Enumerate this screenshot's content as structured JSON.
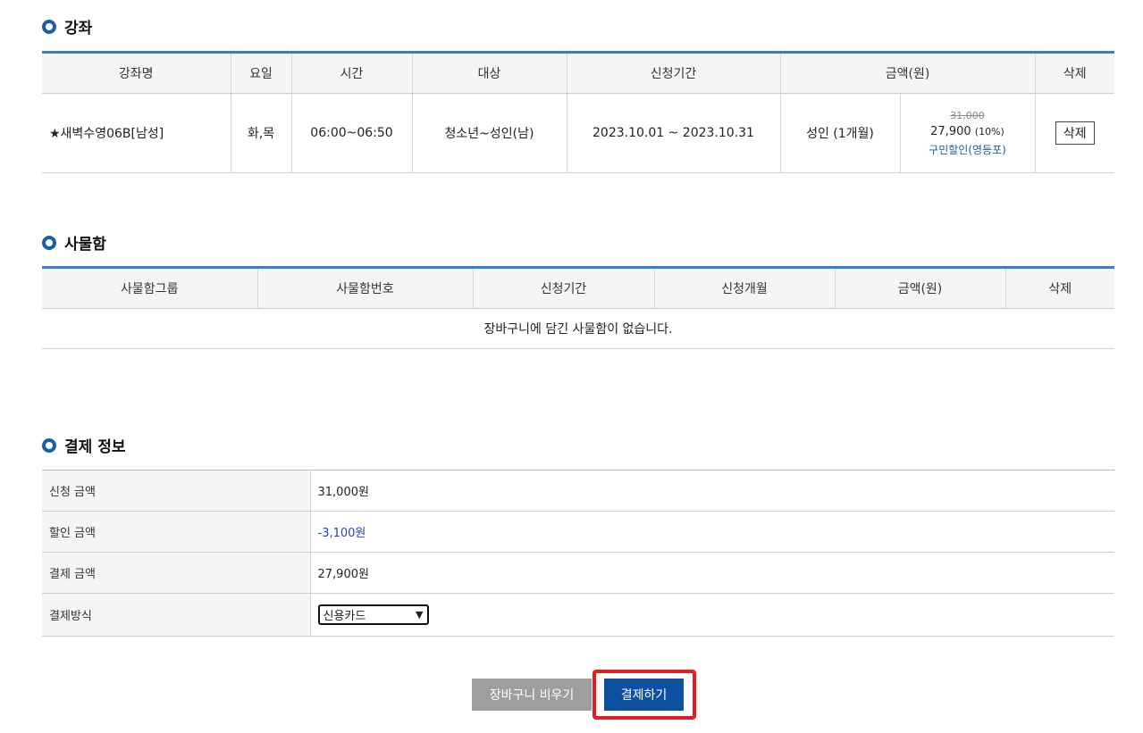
{
  "course_section": {
    "title": "강좌",
    "headers": [
      "강좌명",
      "요일",
      "시간",
      "대상",
      "신청기간",
      "금액(원)",
      "삭제"
    ],
    "row": {
      "name": "★새벽수영06B[남성]",
      "days": "화,목",
      "time": "06:00~06:50",
      "target": "청소년~성인(남)",
      "period": "2023.10.01 ~ 2023.10.31",
      "fee_type": "성인 (1개월)",
      "price_original": "31,000",
      "price_final": "27,900",
      "price_discount": "(10%)",
      "discount_name": "구민할인(영등포)",
      "delete_label": "삭제"
    }
  },
  "locker_section": {
    "title": "사물함",
    "headers": [
      "사물함그룹",
      "사물함번호",
      "신청기간",
      "신청개월",
      "금액(원)",
      "삭제"
    ],
    "empty_message": "장바구니에 담긴 사물함이 없습니다."
  },
  "payment_section": {
    "title": "결제 정보",
    "rows": [
      {
        "label": "신청 금액",
        "value": "31,000원"
      },
      {
        "label": "할인 금액",
        "value": "-3,100원"
      },
      {
        "label": "결제 금액",
        "value": "27,900원"
      }
    ],
    "method_label": "결제방식",
    "method_value": "신용카드"
  },
  "buttons": {
    "clear_cart": "장바구니 비우기",
    "pay": "결제하기"
  },
  "colors": {
    "accent": "#1b5ea8",
    "pay_button": "#0f4fa0",
    "highlight": "#e02020"
  }
}
